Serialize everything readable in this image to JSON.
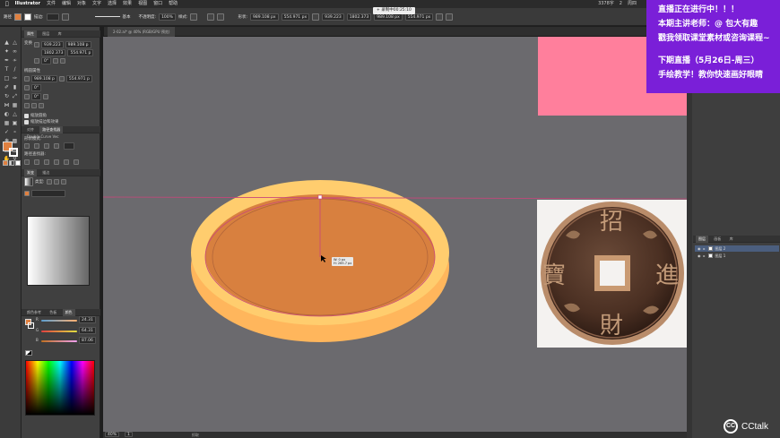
{
  "menubar": {
    "apple": "",
    "app_name": "Illustrator",
    "menus": [
      "文件",
      "编辑",
      "对象",
      "文字",
      "选择",
      "效果",
      "视图",
      "窗口",
      "帮助"
    ],
    "status_right": [
      "3378字",
      "2",
      "周四"
    ]
  },
  "controlbar": {
    "label_path": "路径",
    "stroke_label": "描边:",
    "profile_label": "基本",
    "opacity_label": "不透明度:",
    "opacity_value": "100%",
    "style_label": "样式:",
    "shape_label": "形状:",
    "w_value": "989.108 px",
    "h_value": "554.971 px",
    "x_value": "939.223",
    "y_value": "1802.373",
    "w2_value": "989.108 px",
    "h2_value": "554.971 px"
  },
  "timer": "+ 录制中00:25:10",
  "doctab": {
    "title": "2-02.ai* @ 40% (RGB/GPU 预览)"
  },
  "leftpanel": {
    "tab_props": [
      "属性",
      "图层",
      "库"
    ],
    "section_transform": "变换",
    "x_value": "939.223",
    "y_value": "1802.373",
    "w_value": "989.108 p",
    "h_value": "554.971 p",
    "angle_value": "0°",
    "section_ellipse": "椭圆属性",
    "ew_value": "989.108 p",
    "eh_value": "554.971 p",
    "ellipse_angle": "0°",
    "pie_angle": "0°",
    "scale_corners": "缩放圆角",
    "scale_strokes": "缩放描边和效果",
    "tab_pathfinder": [
      "对齐",
      "路径查找器",
      "Double Curve Vec"
    ],
    "shape_modes_label": "形状模式:",
    "pathfinders_label": "路径查找器:",
    "tab_gradient": [
      "渐变",
      "描边"
    ],
    "type_label": "类型:",
    "tab_color": [
      "颜色参考",
      "色板",
      "颜色"
    ],
    "slider_values": [
      "24.31",
      "64.31",
      "87.06"
    ],
    "slider_labels": [
      "R",
      "G",
      "B"
    ]
  },
  "layers": {
    "tabs": [
      "图层",
      "画板",
      "库"
    ],
    "items": [
      {
        "name": "图层 2",
        "selected": true
      },
      {
        "name": "图层 1",
        "selected": false
      }
    ]
  },
  "statusbar": {
    "zoom": "40%",
    "page": "1",
    "tool": "抓取"
  },
  "coin_chars": {
    "top": "招",
    "bottom": "財",
    "left": "寶",
    "right": "進"
  },
  "measure_tooltip": [
    "W: 0 px",
    "H: 265.7 px"
  ],
  "promo": {
    "line1": "直播正在进行中！！！",
    "line2": "本期主讲老师：@ 包大有趣",
    "line3": "戳我领取课堂素材或咨询课程~",
    "line4": "下期直播（5月26日-周三）",
    "line5": "手绘教学！教你快速画好眼睛"
  },
  "watermark": {
    "logo": "CC",
    "text": "CCtalk"
  },
  "colors": {
    "coin_outer": "#ffcd6e",
    "coin_side": "#ffb65c",
    "coin_inner": "#d8803f",
    "selection": "#c8467b",
    "pink": "#ff7f9c",
    "promo_bg": "#7a1fd8",
    "fill_swatch": "#e08040"
  }
}
